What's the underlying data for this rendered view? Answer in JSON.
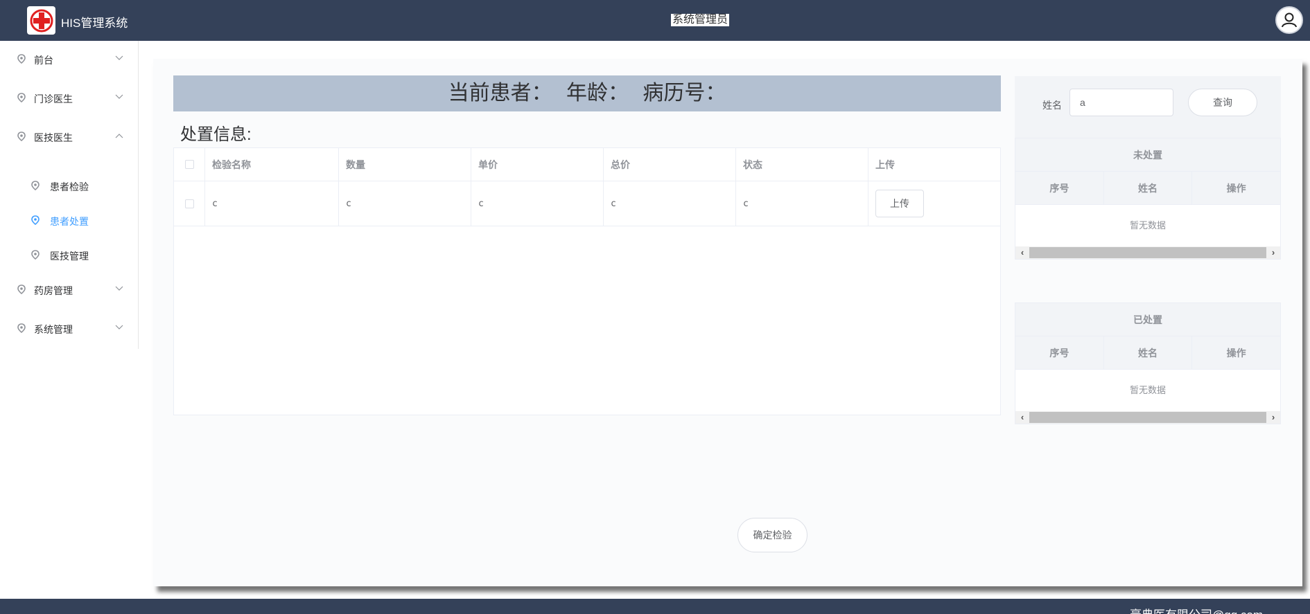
{
  "header": {
    "app_title": "HIS管理系统",
    "user_role": "系统管理员",
    "logo_icon": "red-cross-logo",
    "avatar_icon": "user-icon"
  },
  "sidebar": {
    "items": [
      {
        "label": "前台",
        "expanded": false
      },
      {
        "label": "门诊医生",
        "expanded": false
      },
      {
        "label": "医技医生",
        "expanded": true
      },
      {
        "label": "药房管理",
        "expanded": false
      },
      {
        "label": "系统管理",
        "expanded": false
      }
    ],
    "sub_items": [
      {
        "label": "患者检验",
        "active": false
      },
      {
        "label": "患者处置",
        "active": true
      },
      {
        "label": "医技管理",
        "active": false
      }
    ],
    "active_color": "#409eff"
  },
  "main": {
    "patient_bar": {
      "patient_label": "当前患者：",
      "age_label": "年龄：",
      "record_label": "病历号："
    },
    "section_title": "处置信息:",
    "table": {
      "headers": [
        "检验名称",
        "数量",
        "单价",
        "总价",
        "状态",
        "上传"
      ],
      "rows": [
        {
          "name": "c",
          "quantity": "c",
          "price": "c",
          "total": "c",
          "status": "c",
          "upload_label": "上传"
        }
      ]
    },
    "confirm_button": "确定检验"
  },
  "right": {
    "search": {
      "label": "姓名",
      "value": "a",
      "button": "查询"
    },
    "pending": {
      "title": "未处置",
      "headers": [
        "序号",
        "姓名",
        "操作"
      ],
      "empty_text": "暂无数据"
    },
    "done": {
      "title": "已处置",
      "headers": [
        "序号",
        "姓名",
        "操作"
      ],
      "empty_text": "暂无数据"
    }
  },
  "footer": {
    "text": "豪典医有限公司@qq.com"
  },
  "colors": {
    "header_bg": "#344159",
    "patient_bar_bg": "#b3c0d1",
    "logo_red": "#e02020"
  }
}
